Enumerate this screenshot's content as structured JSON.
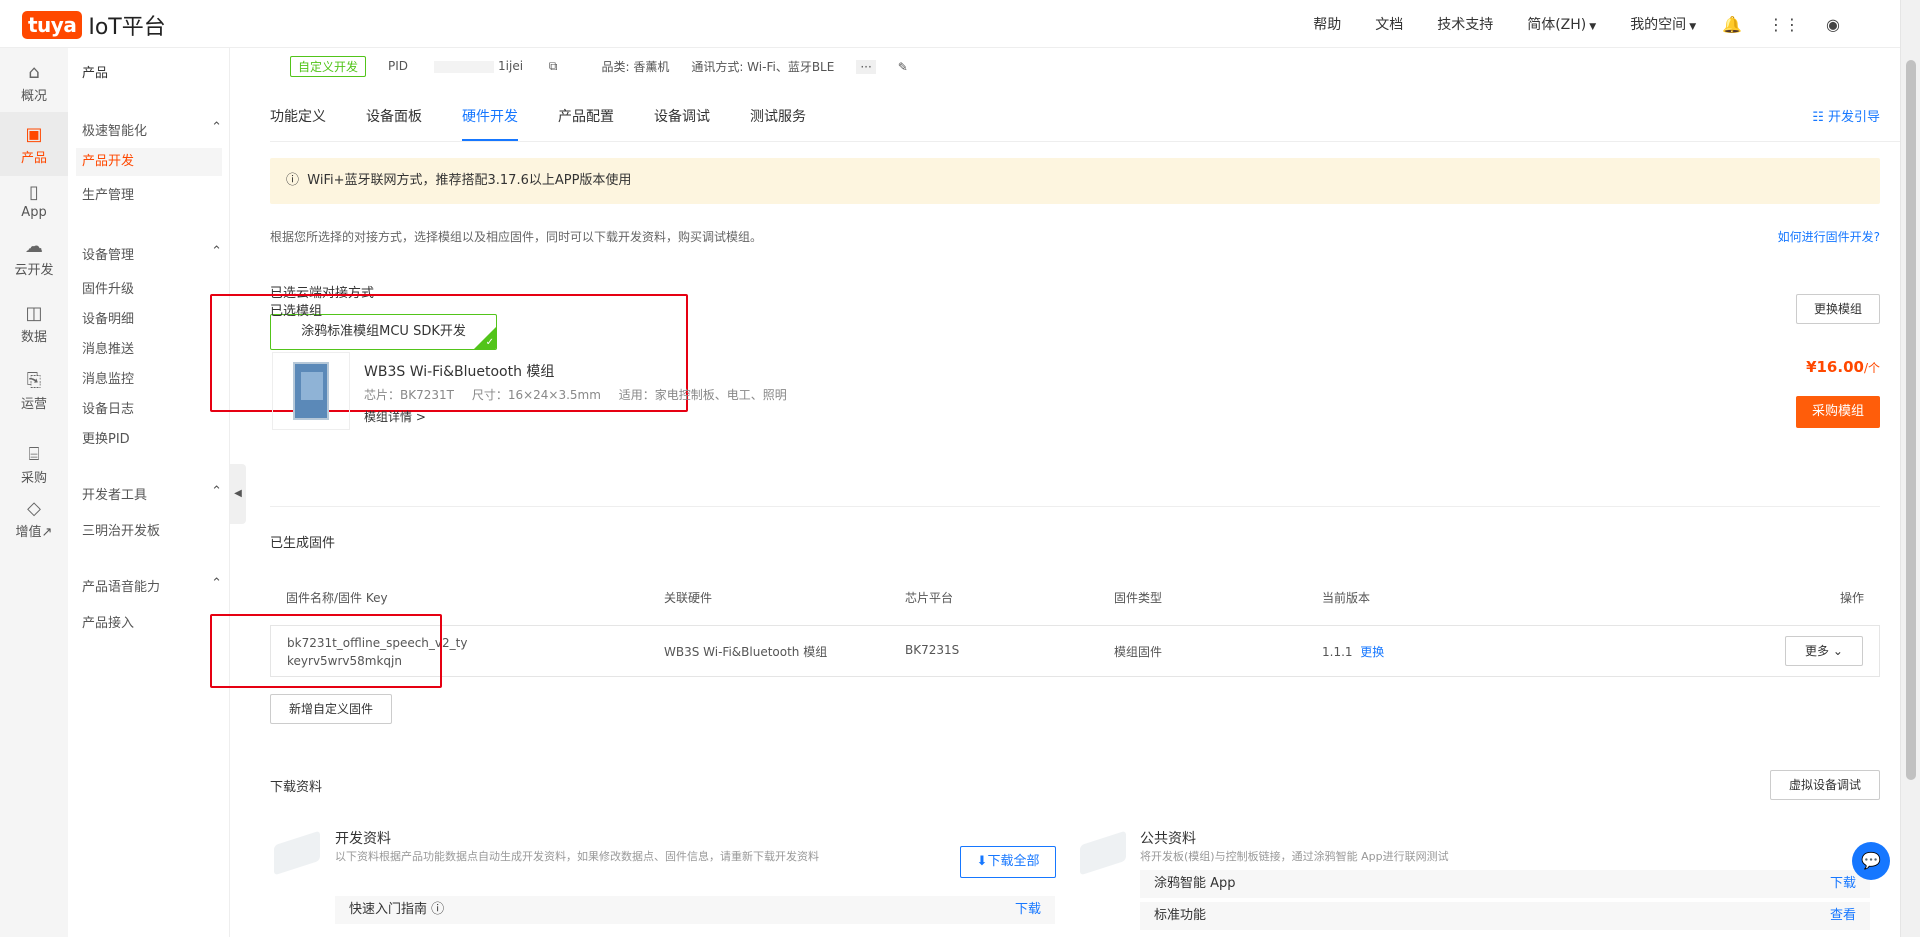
{
  "brand": {
    "badge": "tuya",
    "title": "IoT平台"
  },
  "topnav": {
    "help": "帮助",
    "docs": "文档",
    "support": "技术支持",
    "lang": "简体(ZH)",
    "space": "我的空间"
  },
  "rail": [
    "概况",
    "产品",
    "App",
    "云开发",
    "数据",
    "运营",
    "采购",
    "增值↗"
  ],
  "sidebar": {
    "title": "产品",
    "group1": "极速智能化",
    "group1_items": [
      "产品开发",
      "生产管理"
    ],
    "group2": "设备管理",
    "group2_items": [
      "固件升级",
      "设备明细",
      "消息推送",
      "消息监控",
      "设备日志",
      "更换PID"
    ],
    "group3": "开发者工具",
    "group3_items": [
      "三明治开发板"
    ],
    "group4": "产品语音能力",
    "group4_items": [
      "产品接入"
    ]
  },
  "product": {
    "tag": "自定义开发",
    "pid": "PID",
    "pid_tail": "1ijei",
    "category": "品类: 香薰机",
    "protocol": "通讯方式: Wi-Fi、蓝牙BLE",
    "more": "···"
  },
  "tabs": [
    "功能定义",
    "设备面板",
    "硬件开发",
    "产品配置",
    "设备调试",
    "测试服务"
  ],
  "guide": "开发引导",
  "notice": "WiFi+蓝牙联网方式，推荐搭配3.17.6以上APP版本使用",
  "desc": "根据您所选择的对接方式，选择模组以及相应固件，同时可以下载开发资料，购买调试模组。",
  "how_link": "如何进行固件开发?",
  "cloud": {
    "title": "已选云端对接方式",
    "option": "涂鸦标准模组MCU SDK开发"
  },
  "module": {
    "title": "已选模组",
    "change": "更换模组",
    "name": "WB3S Wi-Fi&Bluetooth 模组",
    "chip": "芯片：BK7231T",
    "size": "尺寸：16×24×3.5mm",
    "use": "适用：家电控制板、电工、照明",
    "detail": "模组详情 >",
    "price": "¥16.00",
    "price_unit": "/个",
    "buy": "采购模组"
  },
  "firmware": {
    "title": "已生成固件",
    "headers": [
      "固件名称/固件 Key",
      "关联硬件",
      "芯片平台",
      "固件类型",
      "当前版本",
      "操作"
    ],
    "row": {
      "name": "bk7231t_offline_speech_v2_ty",
      "key": "keyrv5wrv58mkqjn",
      "hardware": "WB3S Wi-Fi&Bluetooth 模组",
      "platform": "BK7231S",
      "type": "模组固件",
      "version": "1.1.1",
      "change": "更换",
      "more": "更多"
    },
    "add": "新增自定义固件"
  },
  "download": {
    "title": "下载资料",
    "virtual": "虚拟设备调试",
    "dev_title": "开发资料",
    "dev_sub": "以下资料根据产品功能数据点自动生成开发资料，如果修改数据点、固件信息，请重新下载开发资料",
    "dev_btn": "下载全部",
    "dev_row": "快速入门指南",
    "dev_row_action": "下载",
    "pub_title": "公共资料",
    "pub_sub": "将开发板(模组)与控制板链接，通过涂鸦智能 App进行联网测试",
    "pub_rows": [
      {
        "label": "涂鸦智能 App",
        "action": "下载"
      },
      {
        "label": "标准功能",
        "action": "查看"
      }
    ]
  }
}
